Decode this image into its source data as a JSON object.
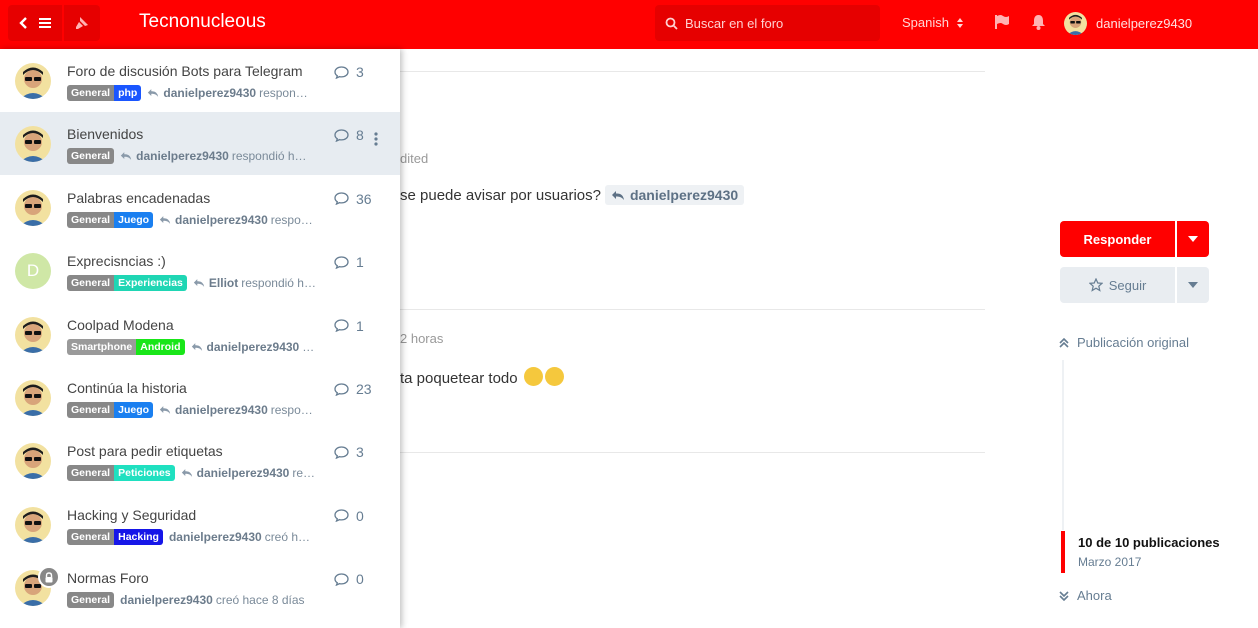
{
  "header": {
    "brand": "Tecnonucleous",
    "search_placeholder": "Buscar en el foro",
    "language": "Spanish",
    "username": "danielperez9430",
    "accent": "#ff0000"
  },
  "icons": [
    "back-icon",
    "menu-icon",
    "pin-icon",
    "search-icon",
    "sort-icon",
    "flag-icon",
    "bell-icon",
    "reply-icon",
    "comment-icon",
    "kebab-icon",
    "lock-icon",
    "star-icon",
    "chevron-down-icon",
    "double-chevron-up-icon",
    "double-chevron-down-icon"
  ],
  "background": {
    "edited": "dited",
    "post1_text": "se puede avisar por usuarios?",
    "post1_mention": "danielperez9430",
    "post2_time": "2 horas",
    "post2_text": "ta poquetear todo"
  },
  "sidebar": {
    "reply_label": "Responder",
    "follow_label": "Seguir",
    "original_post": "Publicación original",
    "post_count": "10 de 10 publicaciones",
    "date": "Marzo 2017",
    "now": "Ahora"
  },
  "discussions": [
    {
      "title": "Foro de discusión Bots para Telegram",
      "count": "3",
      "tags": [
        {
          "label": "General",
          "color": "#888888"
        },
        {
          "label": "php",
          "color": "#1a56ff"
        }
      ],
      "user": "danielperez9430",
      "action": "respon…",
      "reply": true
    },
    {
      "title": "Bienvenidos",
      "count": "8",
      "tags": [
        {
          "label": "General",
          "color": "#888888"
        }
      ],
      "user": "danielperez9430",
      "action": "respondió h…",
      "reply": true,
      "active": true
    },
    {
      "title": "Palabras encadenadas",
      "count": "36",
      "tags": [
        {
          "label": "General",
          "color": "#888888"
        },
        {
          "label": "Juego",
          "color": "#1a7ff0"
        }
      ],
      "user": "danielperez9430",
      "action": "respo…",
      "reply": true
    },
    {
      "title": "Exprecisncias :)",
      "count": "1",
      "tags": [
        {
          "label": "General",
          "color": "#888888"
        },
        {
          "label": "Experiencias",
          "color": "#1fd6b4"
        }
      ],
      "user": "Elliot",
      "action": "respondió h…",
      "reply": true,
      "letter": "D",
      "letter_color": "#cfe7a6"
    },
    {
      "title": "Coolpad Modena",
      "count": "1",
      "tags": [
        {
          "label": "Smartphone",
          "color": "#9a9a9a"
        },
        {
          "label": "Android",
          "color": "#19e619"
        }
      ],
      "user": "danielperez9430",
      "action": "…",
      "reply": true
    },
    {
      "title": "Continúa la historia",
      "count": "23",
      "tags": [
        {
          "label": "General",
          "color": "#888888"
        },
        {
          "label": "Juego",
          "color": "#1a7ff0"
        }
      ],
      "user": "danielperez9430",
      "action": "respo…",
      "reply": true
    },
    {
      "title": "Post para pedir etiquetas",
      "count": "3",
      "tags": [
        {
          "label": "General",
          "color": "#888888"
        },
        {
          "label": "Peticiones",
          "color": "#1fe0c0"
        }
      ],
      "user": "danielperez9430",
      "action": "re…",
      "reply": true
    },
    {
      "title": "Hacking y Seguridad",
      "count": "0",
      "tags": [
        {
          "label": "General",
          "color": "#888888"
        },
        {
          "label": "Hacking",
          "color": "#1616e8"
        }
      ],
      "user": "danielperez9430",
      "action": "creó h…",
      "reply": false
    },
    {
      "title": "Normas Foro",
      "count": "0",
      "tags": [
        {
          "label": "General",
          "color": "#888888"
        }
      ],
      "user": "danielperez9430",
      "action": "creó hace 8 días",
      "reply": false,
      "locked": true
    }
  ]
}
